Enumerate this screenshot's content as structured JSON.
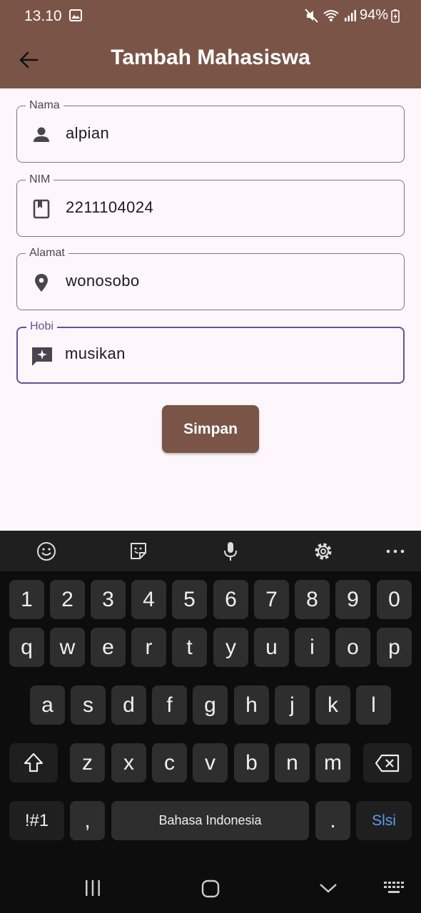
{
  "status_bar": {
    "time": "13.10",
    "battery": "94%"
  },
  "app_bar": {
    "title": "Tambah Mahasiswa"
  },
  "form": {
    "fields": [
      {
        "label": "Nama",
        "icon": "person-icon",
        "value": "alpian"
      },
      {
        "label": "NIM",
        "icon": "book-icon",
        "value": "2211104024"
      },
      {
        "label": "Alamat",
        "icon": "location-pin-icon",
        "value": "wonosobo"
      },
      {
        "label": "Hobi",
        "icon": "sparkle-chat-icon",
        "value": "musikan"
      }
    ],
    "save_label": "Simpan"
  },
  "colors": {
    "brand": "#7a5547",
    "focus": "#6a4f98",
    "background": "#fdf7fc"
  },
  "keyboard": {
    "number_row": [
      "1",
      "2",
      "3",
      "4",
      "5",
      "6",
      "7",
      "8",
      "9",
      "0"
    ],
    "row1": [
      "q",
      "w",
      "e",
      "r",
      "t",
      "y",
      "u",
      "i",
      "o",
      "p"
    ],
    "row2": [
      "a",
      "s",
      "d",
      "f",
      "g",
      "h",
      "j",
      "k",
      "l"
    ],
    "row3": [
      "z",
      "x",
      "c",
      "v",
      "b",
      "n",
      "m"
    ],
    "symbols_label": "!#1",
    "comma_label": ",",
    "space_label": "Bahasa Indonesia",
    "period_label": ".",
    "action_label": "Slsi"
  }
}
